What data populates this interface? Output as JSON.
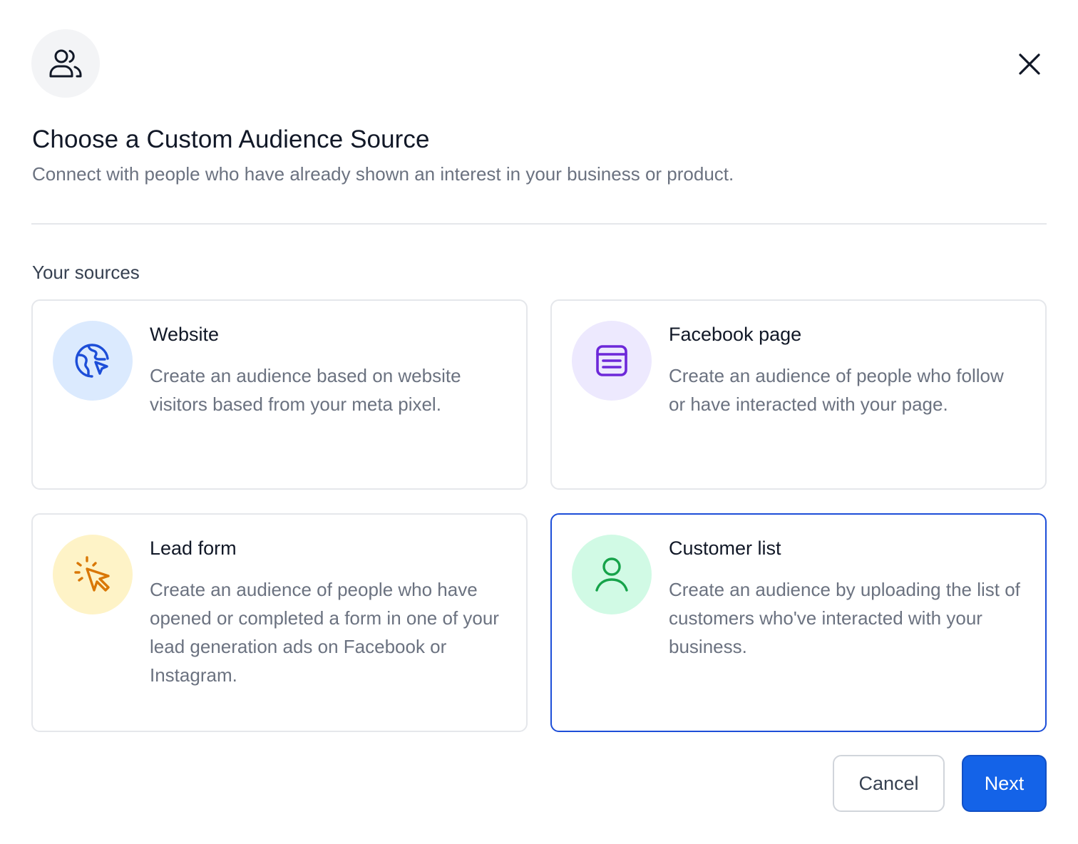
{
  "dialog": {
    "title": "Choose a Custom Audience Source",
    "subtitle": "Connect with people who have already shown an interest in your business or product.",
    "header_icon": "users-icon",
    "close_icon": "close-icon"
  },
  "section": {
    "label": "Your sources"
  },
  "sources": [
    {
      "title": "Website",
      "description": "Create an audience based on website visitors based from your meta pixel.",
      "icon": "globe-cursor-icon",
      "icon_bg": "#dbeafe",
      "icon_color": "#1d4ed8"
    },
    {
      "title": "Facebook page",
      "description": "Create an audience of people who follow or have interacted with your page.",
      "icon": "document-list-icon",
      "icon_bg": "#ede9fe",
      "icon_color": "#6d28d9"
    },
    {
      "title": "Lead form",
      "description": "Create an audience of people who have opened or completed a form in one of your lead generation ads on Facebook or Instagram.",
      "icon": "cursor-click-icon",
      "icon_bg": "#fef3c7",
      "icon_color": "#d97706"
    },
    {
      "title": "Customer list",
      "description": "Create an audience by uploading the list of customers who've interacted with your business.",
      "icon": "user-icon",
      "icon_bg": "#d1fae5",
      "icon_color": "#16a34a",
      "selected": true
    }
  ],
  "actions": {
    "cancel_label": "Cancel",
    "next_label": "Next"
  },
  "colors": {
    "primary": "#1463e8",
    "selected_border": "#1d4ed8",
    "card_border": "#e5e7eb"
  }
}
